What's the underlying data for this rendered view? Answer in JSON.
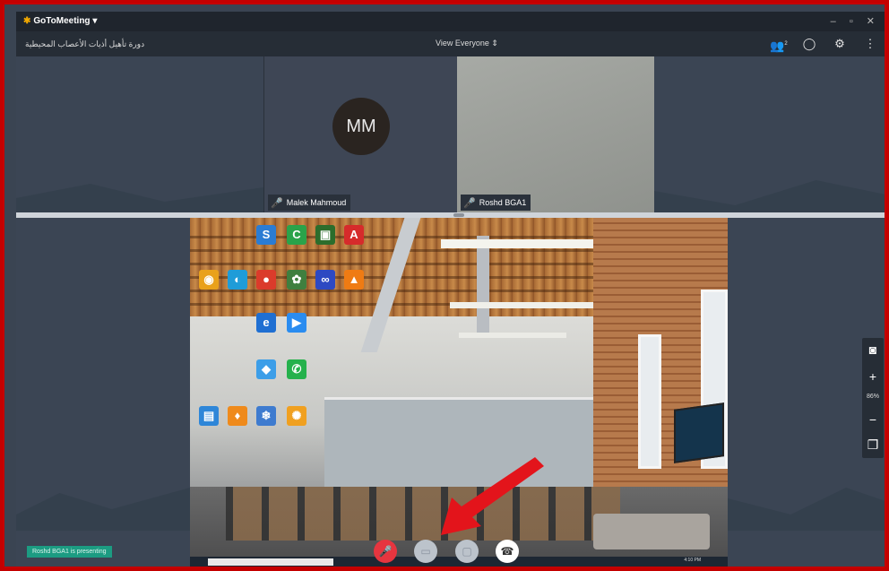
{
  "app": {
    "name": "GoToMeeting",
    "logo_glyph": "✱",
    "dropdown_glyph": "▾",
    "window_controls": "– ▫ ✕"
  },
  "toolbar": {
    "meeting_name": "دورة تأهيل أذيات الأعصاب المحيطية",
    "view_label": "View Everyone",
    "view_chevron": "⇕",
    "attendee_count": "2",
    "icons": [
      "attendees-icon",
      "chat-icon",
      "settings-icon",
      "more-icon"
    ]
  },
  "participants": [
    {
      "initials": "MM",
      "name": "Malek Mahmoud",
      "muted": true
    },
    {
      "initials": "",
      "name": "Roshd BGA1",
      "muted": true
    }
  ],
  "desktop_icons": [
    {
      "glyph": "S",
      "color": "#2b7cd3"
    },
    {
      "glyph": "C",
      "color": "#2aa34a"
    },
    {
      "glyph": "▣",
      "color": "#2c6d2c"
    },
    {
      "glyph": "A",
      "color": "#d62b2b"
    },
    {
      "glyph": "◉",
      "color": "#e9a11b"
    },
    {
      "glyph": "◐",
      "color": "#1f9cd8"
    },
    {
      "glyph": "●",
      "color": "#db3b2b"
    },
    {
      "glyph": "✿",
      "color": "#3f7f3f"
    },
    {
      "glyph": "∞",
      "color": "#2d49c2"
    },
    {
      "glyph": "▲",
      "color": "#ef7b13"
    },
    {
      "glyph": "e",
      "color": "#1f6fd2"
    },
    {
      "glyph": "▶",
      "color": "#2a8cf0"
    },
    {
      "glyph": "◆",
      "color": "#3c9ee8"
    },
    {
      "glyph": "✆",
      "color": "#25b14c"
    },
    {
      "glyph": "♦",
      "color": "#ef8a1b"
    },
    {
      "glyph": "❄",
      "color": "#3e7bcf"
    },
    {
      "glyph": "✺",
      "color": "#f0a020"
    },
    {
      "glyph": "▤",
      "color": "#2e86d8"
    }
  ],
  "controls": {
    "mic_glyph": "🎤",
    "chat_glyph": "▭",
    "screen_glyph": "▢",
    "leave_glyph": "☎"
  },
  "zoom": {
    "level": "86%",
    "camera_glyph": "◙",
    "plus_glyph": "+",
    "minus_glyph": "−",
    "copy_glyph": "❐"
  },
  "status": {
    "presenting": "Roshd BGA1 is presenting"
  },
  "taskbar": {
    "time": "4:10 PM"
  },
  "colors": {
    "accent": "#f2a900",
    "muted_red": "#e6353f",
    "presenting_green": "#1c9c82"
  }
}
